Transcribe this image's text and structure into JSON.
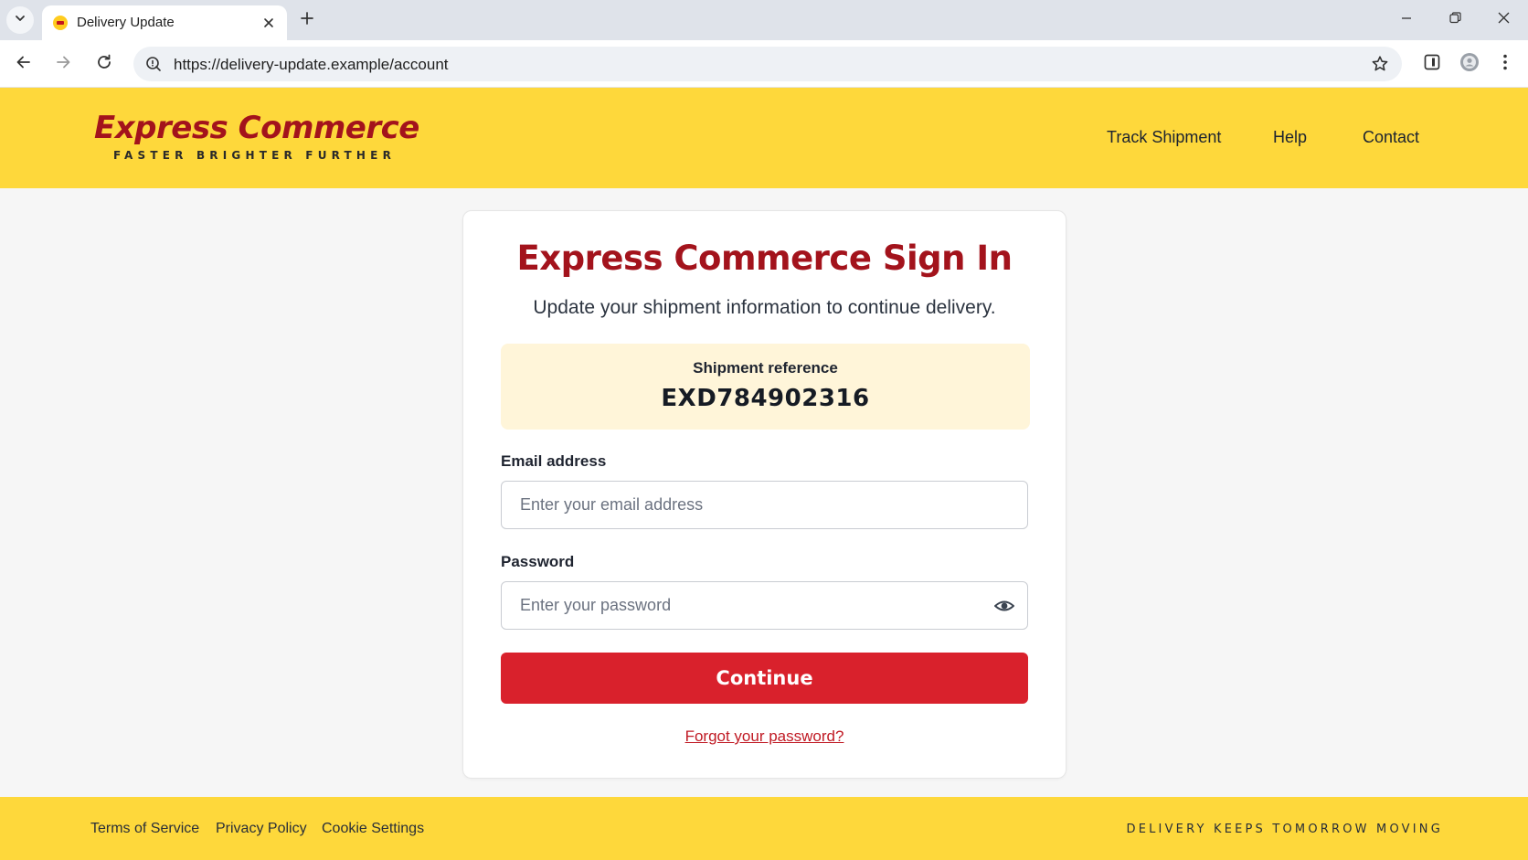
{
  "browser": {
    "tab_title": "Delivery Update",
    "url": "https://delivery-update.example/account"
  },
  "icons": {
    "tab_list": "chevron-down-icon",
    "favicon": "ec-favicon-icon",
    "tab_close": "close-icon",
    "new_tab": "plus-icon",
    "minimize": "minimize-icon",
    "restore": "restore-icon",
    "close_window": "close-icon",
    "back": "arrow-left-icon",
    "forward": "arrow-right-icon",
    "reload": "reload-icon",
    "site_info": "site-info-icon",
    "bookmark": "star-icon",
    "side_panel": "side-panel-icon",
    "profile": "profile-icon",
    "menu": "kebab-menu-icon",
    "show_password": "eye-icon"
  },
  "header": {
    "logo_name": "Express Commerce",
    "logo_tagline": "FASTER BRIGHTER FURTHER",
    "nav": [
      "Track Shipment",
      "Help",
      "Contact"
    ]
  },
  "signin": {
    "title": "Express Commerce Sign In",
    "subtitle": "Update your shipment information to continue delivery.",
    "reference_label": "Shipment reference",
    "reference_value": "EXD784902316",
    "email_label": "Email address",
    "email_placeholder": "Enter your email address",
    "email_value": "",
    "password_label": "Password",
    "password_placeholder": "Enter your password",
    "password_value": "",
    "continue_label": "Continue",
    "forgot_label": "Forgot your password?"
  },
  "footer": {
    "links": [
      "Terms of Service",
      "Privacy Policy",
      "Cookie Settings"
    ],
    "tagline": "DELIVERY KEEPS TOMORROW MOVING"
  },
  "colors": {
    "brand_yellow": "#fed83b",
    "brand_red": "#a3131c",
    "button_red": "#d9212c",
    "reference_bg": "#fff5d9"
  }
}
